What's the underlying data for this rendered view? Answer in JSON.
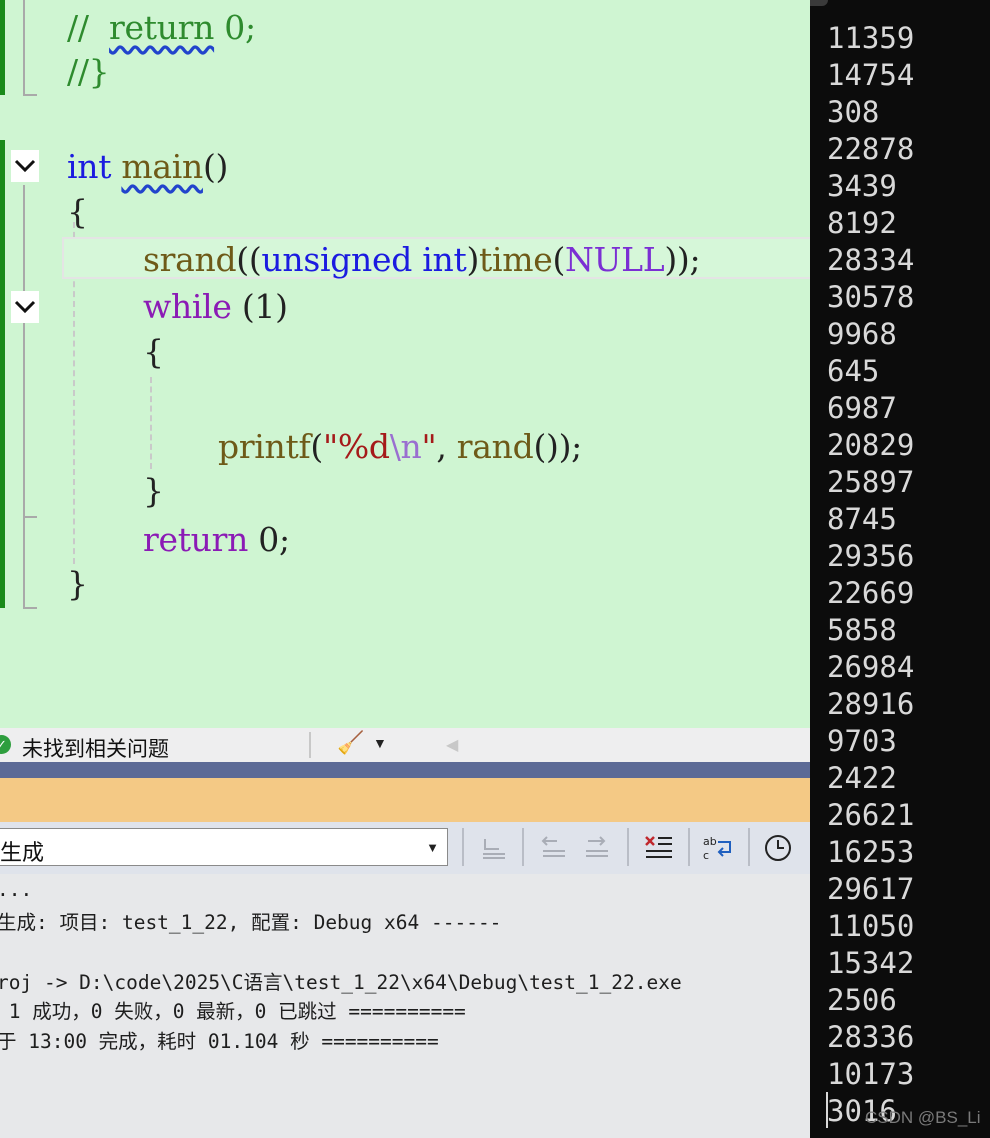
{
  "editor": {
    "lines": {
      "l1_prefix": "//  ",
      "l1_return": "return",
      "l1_rest": " 0;",
      "l2": "//}",
      "l3_kw": "int",
      "l3_fn": "main",
      "l3_rest": "()",
      "l4": "{",
      "l5_fn": "srand",
      "l5_a": "((",
      "l5_kw1": "unsigned",
      "l5_kw2": "int",
      "l5_b": ")",
      "l5_fn2": "time",
      "l5_c": "(",
      "l5_mac": "NULL",
      "l5_d": "));",
      "l6_kw": "while",
      "l6_rest": " (1)",
      "l7": "{",
      "l9_fn": "printf",
      "l9_a": "(",
      "l9_str1": "\"%d",
      "l9_esc": "\\n",
      "l9_str2": "\"",
      "l9_b": ", ",
      "l9_fn2": "rand",
      "l9_c": "());",
      "l10": "}",
      "l11_kw": "return",
      "l11_rest": " 0;",
      "l12": "}"
    }
  },
  "status": {
    "message": "未找到相关问题"
  },
  "output": {
    "source_select": "生成",
    "log": [
      "...",
      "生成: 项目: test_1_22, 配置: Debug x64 ------",
      "roj -> D:\\code\\2025\\C语言\\test_1_22\\x64\\Debug\\test_1_22.exe",
      " 1 成功，0 失败，0 最新，0 已跳过 ==========",
      "于 13:00 完成，耗时 01.104 秒 =========="
    ]
  },
  "console": {
    "numbers": [
      "11359",
      "14754",
      "308",
      "22878",
      "3439",
      "8192",
      "28334",
      "30578",
      "9968",
      "645",
      "6987",
      "20829",
      "25897",
      "8745",
      "29356",
      "22669",
      "5858",
      "26984",
      "28916",
      "9703",
      "2422",
      "26621",
      "16253",
      "29617",
      "11050",
      "15342",
      "2506",
      "28336",
      "10173",
      "3016"
    ],
    "watermark": "CSDN @BS_Li"
  },
  "colors": {
    "editor_bg": "#cff5d2",
    "console_bg": "#0c0c0c",
    "keyword": "#1b1be0",
    "control": "#8b1bb5",
    "comment": "#2e8b2e",
    "function": "#6e5a18",
    "string": "#a51a1a"
  }
}
